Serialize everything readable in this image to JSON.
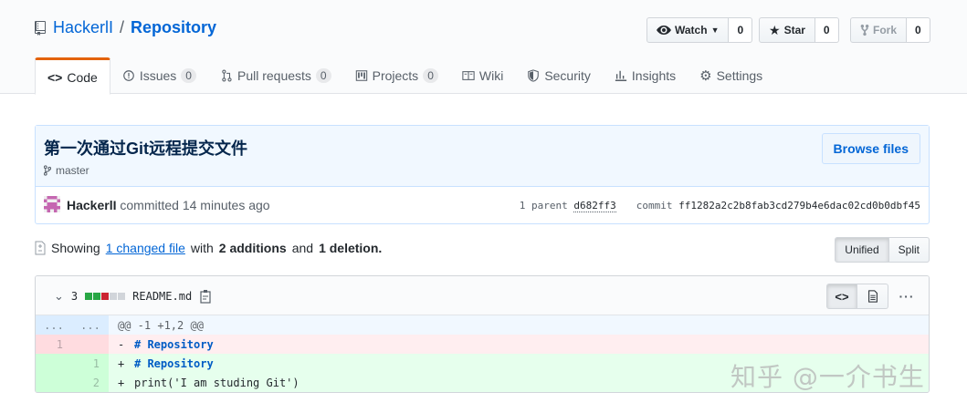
{
  "repo": {
    "owner": "HackerlI",
    "separator": "/",
    "name": "Repository"
  },
  "actions": {
    "watch": {
      "label": "Watch",
      "count": "0"
    },
    "star": {
      "label": "Star",
      "count": "0"
    },
    "fork": {
      "label": "Fork",
      "count": "0"
    }
  },
  "tabs": [
    {
      "label": "Code",
      "counter": ""
    },
    {
      "label": "Issues",
      "counter": "0"
    },
    {
      "label": "Pull requests",
      "counter": "0"
    },
    {
      "label": "Projects",
      "counter": "0"
    },
    {
      "label": "Wiki",
      "counter": ""
    },
    {
      "label": "Security",
      "counter": ""
    },
    {
      "label": "Insights",
      "counter": ""
    },
    {
      "label": "Settings",
      "counter": ""
    }
  ],
  "commit": {
    "title": "第一次通过Git远程提交文件",
    "branch": "master",
    "browse_label": "Browse files",
    "author": "HackerlI",
    "meta_text": "committed 14 minutes ago",
    "parent_label": "1 parent",
    "parent_sha": "d682ff3",
    "commit_label": "commit",
    "commit_sha": "ff1282a2c2b8fab3cd279b4e6dac02cd0b0dbf45"
  },
  "toc": {
    "showing": "Showing",
    "changed": "1 changed file",
    "with": "with",
    "additions": "2 additions",
    "and": "and",
    "deletions": "1 deletion."
  },
  "view_mode": {
    "unified": "Unified",
    "split": "Split"
  },
  "file": {
    "changes": "3",
    "name": "README.md",
    "diffstat_colors": [
      "#28a745",
      "#28a745",
      "#cb2431",
      "#d1d5da",
      "#d1d5da"
    ],
    "hunk": {
      "old": "...",
      "new": "...",
      "text": "@@ -1 +1,2 @@"
    },
    "lines": [
      {
        "type": "del",
        "old": "1",
        "new": "",
        "marker": "-",
        "text": "# Repository"
      },
      {
        "type": "add",
        "old": "",
        "new": "1",
        "marker": "+",
        "text": "# Repository"
      },
      {
        "type": "add",
        "old": "",
        "new": "2",
        "marker": "+",
        "text": "print('I am studing Git')"
      }
    ]
  },
  "watermark": "知乎 @一介书生"
}
